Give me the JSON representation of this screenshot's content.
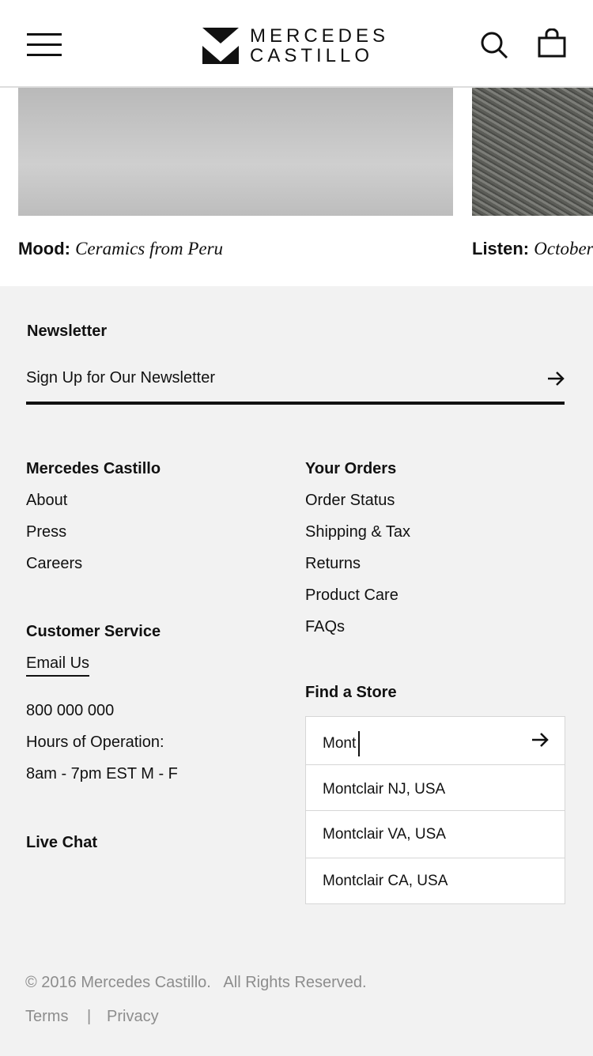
{
  "header": {
    "logo_line1": "MERCEDES",
    "logo_line2": "CASTILLO"
  },
  "features": [
    {
      "label": "Mood:",
      "title": "Ceramics from Peru"
    },
    {
      "label": "Listen:",
      "title": "October"
    }
  ],
  "newsletter": {
    "heading": "Newsletter",
    "placeholder": "Sign Up for Our Newsletter"
  },
  "col1": {
    "heading": "Mercedes Castillo",
    "links": [
      "About",
      "Press",
      "Careers"
    ]
  },
  "col2": {
    "heading": "Your Orders",
    "links": [
      "Order Status",
      "Shipping & Tax",
      "Returns",
      "Product Care",
      "FAQs"
    ]
  },
  "service": {
    "heading": "Customer Service",
    "email": "Email Us",
    "phone": "800 000 000",
    "hours_label": "Hours of Operation:",
    "hours": "8am - 7pm EST M - F",
    "chat": "Live Chat"
  },
  "store": {
    "heading": "Find a Store",
    "value": "Mont",
    "suggestions": [
      "Montclair NJ, USA",
      "Montclair VA, USA",
      "Montclair CA, USA"
    ]
  },
  "footer": {
    "copyright": "© 2016 Mercedes Castillo.",
    "rights": "All Rights Reserved.",
    "terms": "Terms",
    "sep": "|",
    "privacy": "Privacy"
  }
}
